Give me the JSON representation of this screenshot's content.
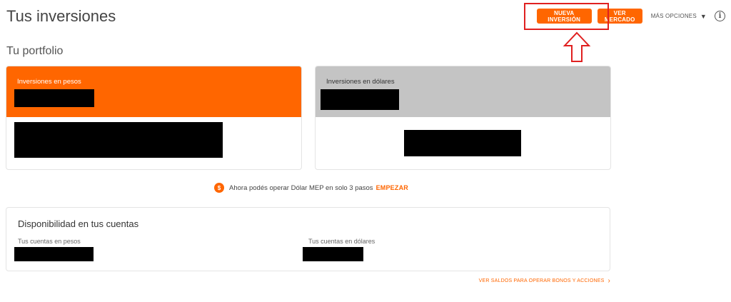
{
  "header": {
    "title": "Tus inversiones",
    "new_investment_label": "NUEVA INVERSIÓN",
    "market_label": "VER MERCADO",
    "more_options_label": "MÁS OPCIONES",
    "more_options_caret": "▼",
    "info_icon": "i"
  },
  "portfolio": {
    "title": "Tu portfolio",
    "pesos_card_label": "Inversiones en pesos",
    "dolares_card_label": "Inversiones en dólares"
  },
  "mep": {
    "icon": "$",
    "text": "Ahora podés operar Dólar MEP en solo 3 pasos",
    "link": "EMPEZAR"
  },
  "availability": {
    "title": "Disponibilidad en tus cuentas",
    "pesos_label": "Tus cuentas en pesos",
    "dolares_label": "Tus cuentas en dólares"
  },
  "footer": {
    "link": "VER SALDOS PARA OPERAR BONOS Y ACCIONES",
    "chevron": "›"
  },
  "colors": {
    "brand": "#ff6600",
    "card_grey": "#c4c4c4",
    "annotation_red": "#e02020"
  }
}
